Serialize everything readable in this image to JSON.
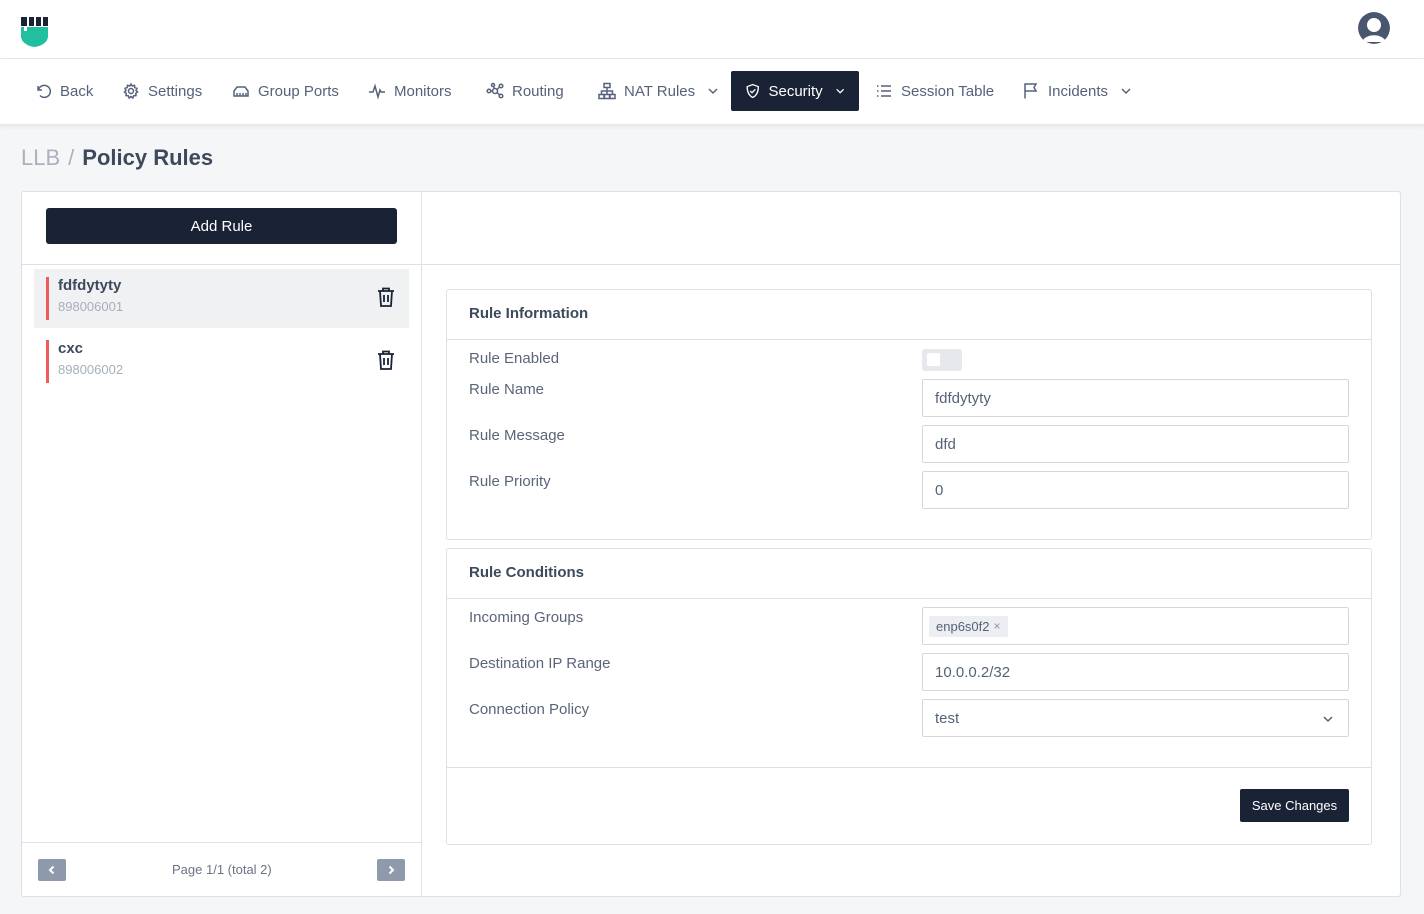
{
  "header": {
    "logo_icon": "brand-logo-icon",
    "avatar_icon": "user-avatar-icon"
  },
  "nav": {
    "items": [
      {
        "label": "Back",
        "icon": "undo-icon"
      },
      {
        "label": "Settings",
        "icon": "gear-icon"
      },
      {
        "label": "Group Ports",
        "icon": "ports-icon"
      },
      {
        "label": "Monitors",
        "icon": "pulse-icon"
      },
      {
        "label": "Routing",
        "icon": "routing-icon"
      },
      {
        "label": "NAT Rules",
        "icon": "network-icon"
      },
      {
        "label": "Security",
        "icon": "shield-icon"
      },
      {
        "label": "Session Table",
        "icon": "list-icon"
      },
      {
        "label": "Incidents",
        "icon": "flag-icon"
      }
    ],
    "active": "Security"
  },
  "breadcrumb": {
    "root": "LLB",
    "separator": "/",
    "current": "Policy Rules"
  },
  "sidebar": {
    "add_rule_label": "Add Rule",
    "rules": [
      {
        "name": "fdfdytyty",
        "id": "898006001",
        "selected": true
      },
      {
        "name": "cxc",
        "id": "898006002",
        "selected": false
      }
    ],
    "pager_text": "Page 1/1 (total 2)"
  },
  "rule_information": {
    "title": "Rule Information",
    "enabled_label": "Rule Enabled",
    "enabled": false,
    "name_label": "Rule Name",
    "name_value": "fdfdytyty",
    "message_label": "Rule Message",
    "message_value": "dfd",
    "priority_label": "Rule Priority",
    "priority_value": "0"
  },
  "rule_conditions": {
    "title": "Rule Conditions",
    "incoming_groups_label": "Incoming Groups",
    "incoming_groups": [
      "enp6s0f2"
    ],
    "tag_remove": "×",
    "dest_ip_label": "Destination IP Range",
    "dest_ip_value": "10.0.0.2/32",
    "conn_policy_label": "Connection Policy",
    "conn_policy_value": "test"
  },
  "save_label": "Save Changes",
  "colors": {
    "primary": "#1a2236",
    "accent_bar": "#f05a5a",
    "logo_green": "#1fbf9f"
  }
}
